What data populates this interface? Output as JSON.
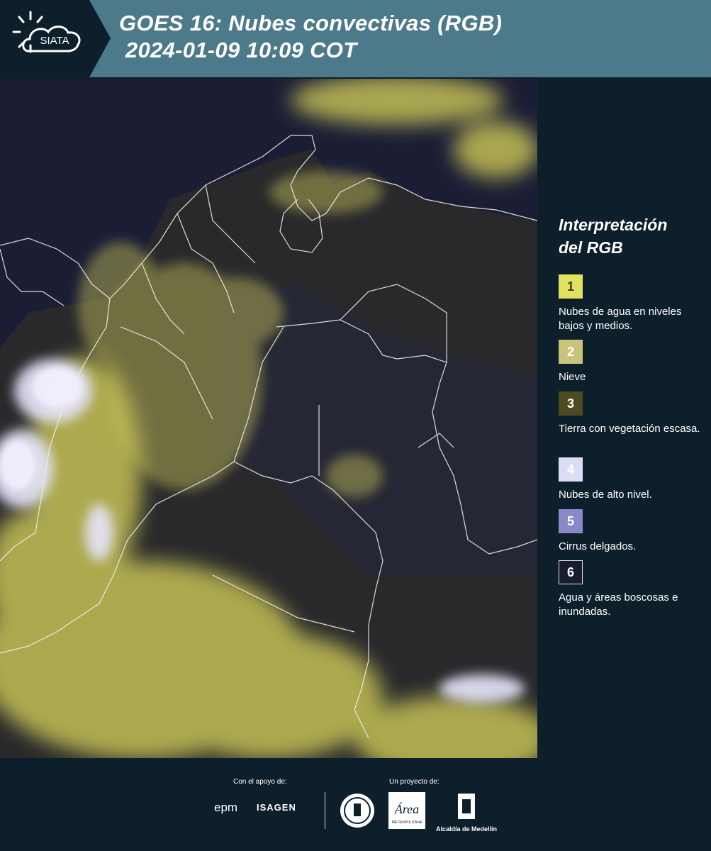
{
  "header": {
    "logo_text": "SIATA",
    "title_line1": "GOES 16: Nubes convectivas (RGB)",
    "title_line2": " 2024-01-09 10:09 COT"
  },
  "legend": {
    "title_line1": "Interpretación",
    "title_line2": "del RGB",
    "items": [
      {
        "number": "1",
        "label": "Nubes de agua en niveles bajos y medios.",
        "color": "#e3e160",
        "text_color": "#3a3a10"
      },
      {
        "number": "2",
        "label": "Nieve",
        "color": "#c9c47a",
        "text_color": "#ffffff"
      },
      {
        "number": "3",
        "label": "Tierra con vegetación escasa.",
        "color": "#4c4a1e",
        "text_color": "#ffffff"
      },
      {
        "number": "4",
        "label": "Nubes de alto nivel.",
        "color": "#dcdcf5",
        "text_color": "#ffffff"
      },
      {
        "number": "5",
        "label": "Cirrus delgados.",
        "color": "#8a88c8",
        "text_color": "#ffffff"
      },
      {
        "number": "6",
        "label": "Agua y áreas boscosas e inundadas.",
        "color": "#1a1a30",
        "text_color": "#ffffff"
      }
    ]
  },
  "footer": {
    "support_label": "Con el apoyo de:",
    "project_label": "Un proyecto de:",
    "sponsor1": "epm",
    "sponsor2": "ISAGEN",
    "project_logo2_text": "Área",
    "project_logo2_sub": "METROPOLITANA",
    "project_logo3": "Alcaldía de Medellín"
  }
}
